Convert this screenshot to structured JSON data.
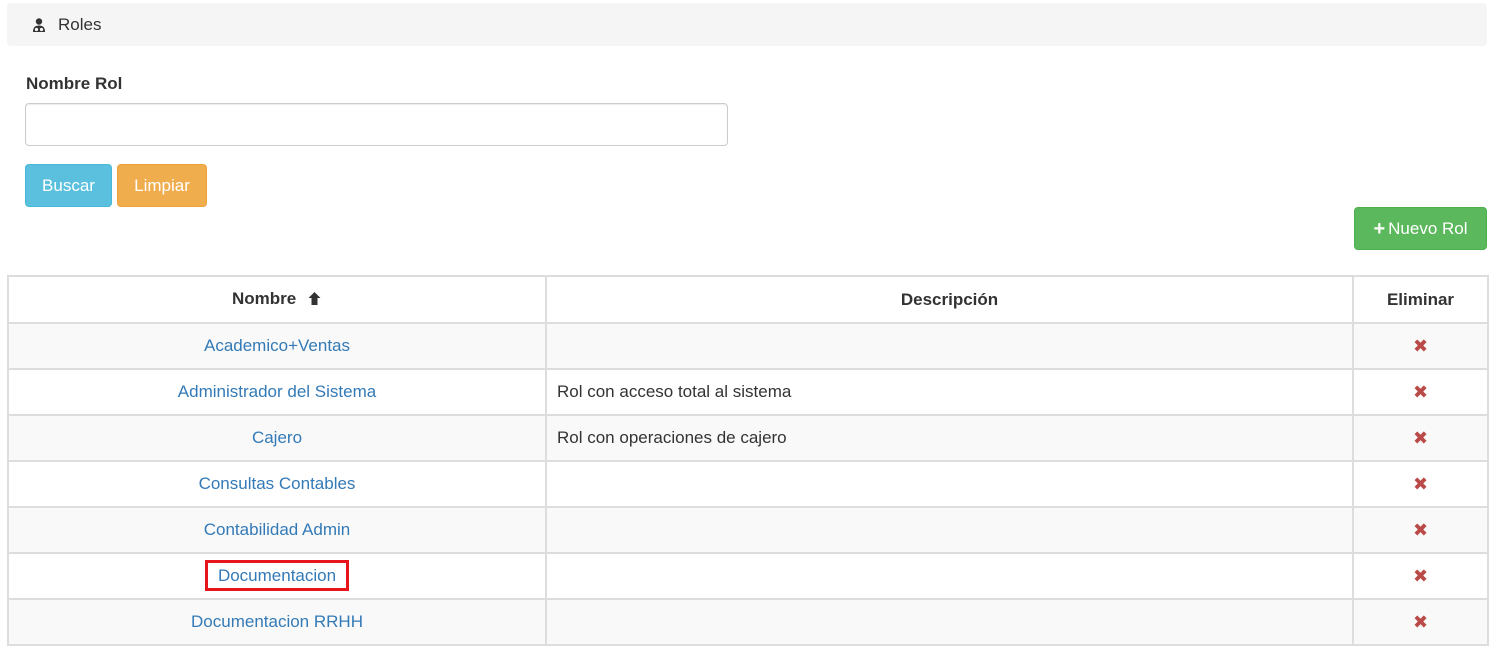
{
  "header": {
    "title": "Roles",
    "icon": "user-secret-icon"
  },
  "filter": {
    "label": "Nombre Rol",
    "value": "",
    "placeholder": ""
  },
  "buttons": {
    "search": "Buscar",
    "clear": "Limpiar",
    "new": "Nuevo Rol"
  },
  "table": {
    "headers": {
      "name": "Nombre",
      "description": "Descripción",
      "delete": "Eliminar"
    },
    "sort": {
      "column": "name",
      "direction": "asc"
    },
    "rows": [
      {
        "name": "Academico+Ventas",
        "description": ""
      },
      {
        "name": "Administrador del Sistema",
        "description": "Rol con acceso total al sistema"
      },
      {
        "name": "Cajero",
        "description": "Rol con operaciones de cajero"
      },
      {
        "name": "Consultas Contables",
        "description": ""
      },
      {
        "name": "Contabilidad Admin",
        "description": ""
      },
      {
        "name": "Documentacion",
        "description": ""
      },
      {
        "name": "Documentacion RRHH",
        "description": ""
      }
    ]
  },
  "colors": {
    "info": "#5bc0de",
    "warning": "#f0ad4e",
    "success": "#5cb85c",
    "link": "#337ab7",
    "danger": "#b94a48",
    "highlight": "#e8141c"
  }
}
